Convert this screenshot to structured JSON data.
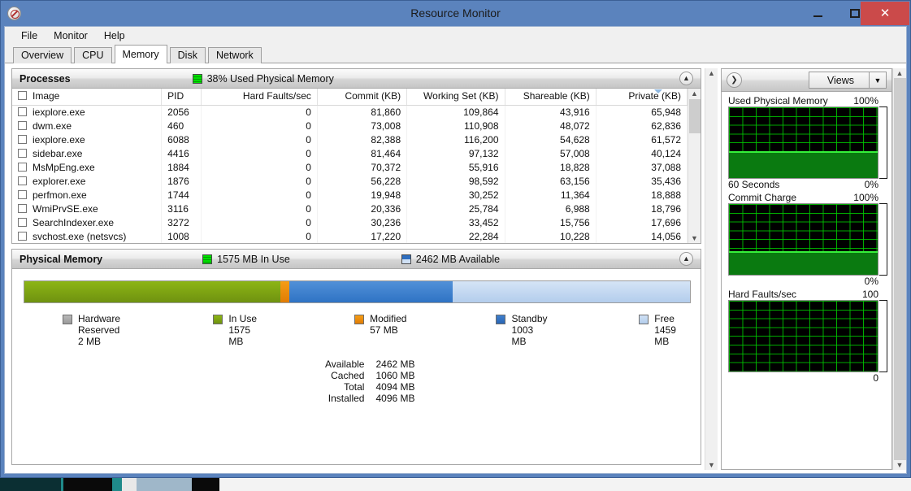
{
  "window": {
    "title": "Resource Monitor",
    "icon": "resource-monitor-icon",
    "minimize": "–",
    "maximize": "□",
    "close": "✕"
  },
  "menu": [
    "File",
    "Monitor",
    "Help"
  ],
  "tabs": [
    {
      "label": "Overview",
      "active": false
    },
    {
      "label": "CPU",
      "active": false
    },
    {
      "label": "Memory",
      "active": true
    },
    {
      "label": "Disk",
      "active": false
    },
    {
      "label": "Network",
      "active": false
    }
  ],
  "processes": {
    "title": "Processes",
    "status": "38% Used Physical Memory",
    "collapse_glyph": "▲",
    "columns": [
      "Image",
      "PID",
      "Hard Faults/sec",
      "Commit (KB)",
      "Working Set (KB)",
      "Shareable (KB)",
      "Private (KB)"
    ],
    "sorted_column": "Private (KB)",
    "rows": [
      {
        "image": "iexplore.exe",
        "pid": "2056",
        "hard_faults": "0",
        "commit": "81,860",
        "working_set": "109,864",
        "shareable": "43,916",
        "private": "65,948"
      },
      {
        "image": "dwm.exe",
        "pid": "460",
        "hard_faults": "0",
        "commit": "73,008",
        "working_set": "110,908",
        "shareable": "48,072",
        "private": "62,836"
      },
      {
        "image": "iexplore.exe",
        "pid": "6088",
        "hard_faults": "0",
        "commit": "82,388",
        "working_set": "116,200",
        "shareable": "54,628",
        "private": "61,572"
      },
      {
        "image": "sidebar.exe",
        "pid": "4416",
        "hard_faults": "0",
        "commit": "81,464",
        "working_set": "97,132",
        "shareable": "57,008",
        "private": "40,124"
      },
      {
        "image": "MsMpEng.exe",
        "pid": "1884",
        "hard_faults": "0",
        "commit": "70,372",
        "working_set": "55,916",
        "shareable": "18,828",
        "private": "37,088"
      },
      {
        "image": "explorer.exe",
        "pid": "1876",
        "hard_faults": "0",
        "commit": "56,228",
        "working_set": "98,592",
        "shareable": "63,156",
        "private": "35,436"
      },
      {
        "image": "perfmon.exe",
        "pid": "1744",
        "hard_faults": "0",
        "commit": "19,948",
        "working_set": "30,252",
        "shareable": "11,364",
        "private": "18,888"
      },
      {
        "image": "WmiPrvSE.exe",
        "pid": "3116",
        "hard_faults": "0",
        "commit": "20,336",
        "working_set": "25,784",
        "shareable": "6,988",
        "private": "18,796"
      },
      {
        "image": "SearchIndexer.exe",
        "pid": "3272",
        "hard_faults": "0",
        "commit": "30,236",
        "working_set": "33,452",
        "shareable": "15,756",
        "private": "17,696"
      },
      {
        "image": "svchost.exe (netsvcs)",
        "pid": "1008",
        "hard_faults": "0",
        "commit": "17,220",
        "working_set": "22,284",
        "shareable": "10,228",
        "private": "14,056"
      }
    ]
  },
  "physical_memory": {
    "title": "Physical Memory",
    "stat_in_use": "1575 MB In Use",
    "stat_available": "2462 MB Available",
    "collapse_glyph": "▲",
    "bar": [
      {
        "name": "Hardware Reserved",
        "value": "2 MB",
        "pct": 0.05
      },
      {
        "name": "In Use",
        "value": "1575 MB",
        "pct": 38.45
      },
      {
        "name": "Modified",
        "value": "57 MB",
        "pct": 1.4
      },
      {
        "name": "Standby",
        "value": "1003 MB",
        "pct": 24.5
      },
      {
        "name": "Free",
        "value": "1459 MB",
        "pct": 35.6
      }
    ],
    "summary": [
      {
        "key": "Available",
        "value": "2462 MB"
      },
      {
        "key": "Cached",
        "value": "1060 MB"
      },
      {
        "key": "Total",
        "value": "4094 MB"
      },
      {
        "key": "Installed",
        "value": "4096 MB"
      }
    ]
  },
  "graph_panel": {
    "expand_glyph": "❯",
    "views_label": "Views",
    "views_caret": "▼"
  },
  "chart_data": [
    {
      "type": "area",
      "title": "Used Physical Memory",
      "ymax_label": "100%",
      "ymin_label": "0%",
      "xlabel": "60 Seconds",
      "ylim": [
        0,
        100
      ],
      "grid": true,
      "series": [
        {
          "name": "Used Physical Memory",
          "values": [
            38,
            38,
            38,
            38,
            38,
            38,
            41,
            41,
            38,
            38,
            41,
            41,
            38,
            38,
            38,
            38
          ]
        }
      ],
      "line_color": "#35f03a",
      "fill_color": "#0a7a10",
      "bg_color": "#000000"
    },
    {
      "type": "area",
      "title": "Commit Charge",
      "ymax_label": "100%",
      "ymin_label": "0%",
      "xlabel": "",
      "ylim": [
        0,
        100
      ],
      "grid": true,
      "series": [
        {
          "name": "Commit Charge",
          "values": [
            33,
            33,
            33,
            33,
            33,
            33,
            33,
            33,
            33,
            33,
            33,
            33,
            33,
            33,
            33,
            33
          ]
        }
      ],
      "line_color": "#35f03a",
      "fill_color": "#0a7a10",
      "bg_color": "#000000"
    },
    {
      "type": "area",
      "title": "Hard Faults/sec",
      "ymax_label": "100",
      "ymin_label": "0",
      "xlabel": "",
      "ylim": [
        0,
        100
      ],
      "grid": true,
      "series": [
        {
          "name": "Hard Faults/sec",
          "values": [
            0,
            0,
            0,
            0,
            0,
            0,
            0,
            0,
            0,
            0,
            0,
            0,
            0,
            0,
            0,
            0
          ]
        }
      ],
      "line_color": "#35f03a",
      "fill_color": "#0a7a10",
      "bg_color": "#000000"
    }
  ]
}
